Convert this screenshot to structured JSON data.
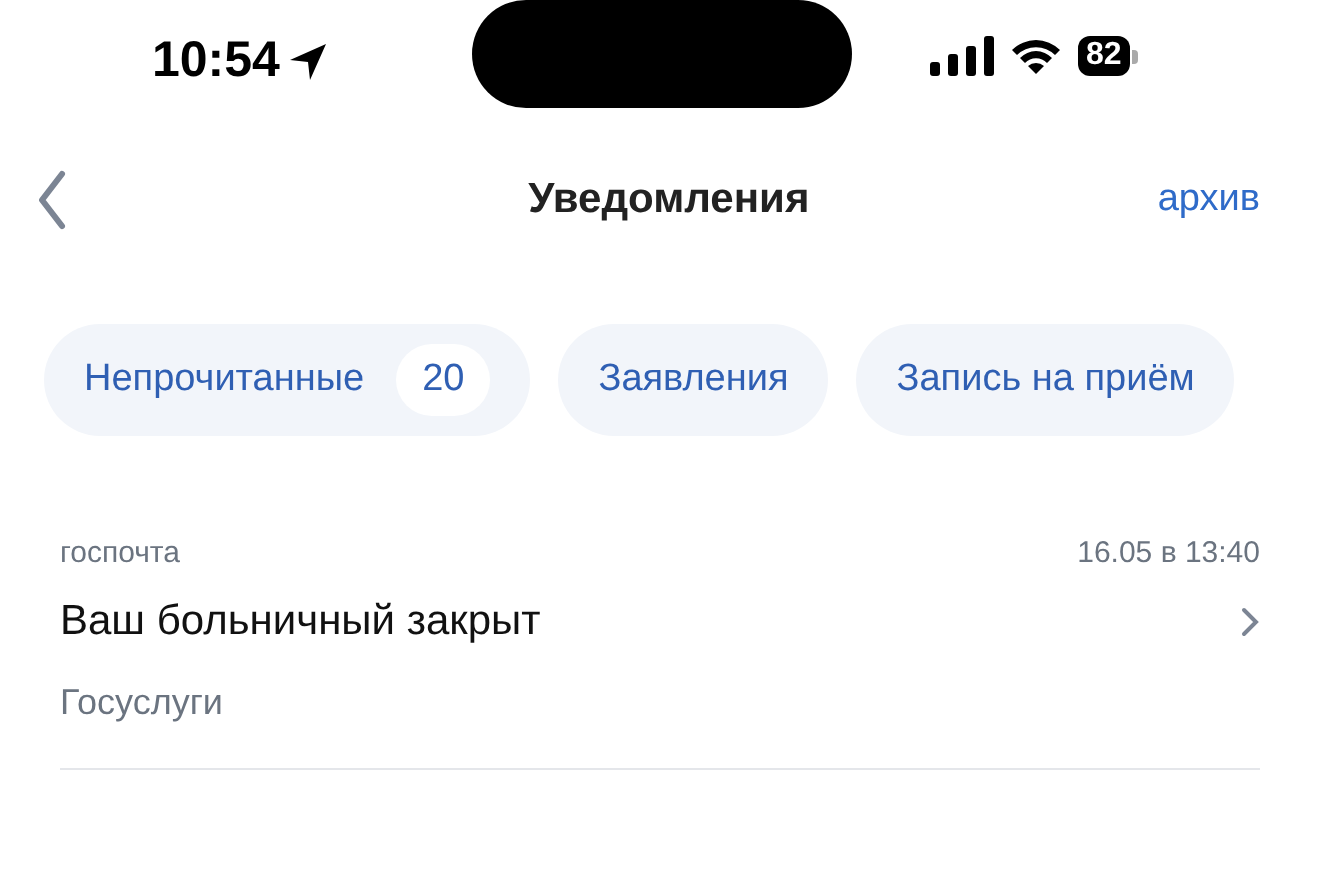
{
  "status_bar": {
    "time": "10:54",
    "battery": "82"
  },
  "nav": {
    "title": "Уведомления",
    "action": "архив"
  },
  "chips": [
    {
      "label": "Непрочитанные",
      "count": "20"
    },
    {
      "label": "Заявления"
    },
    {
      "label": "Запись на приём"
    }
  ],
  "notifications": [
    {
      "source": "госпочта",
      "date": "16.05 в 13:40",
      "title": "Ваш больничный закрыт",
      "sender": "Госуслуги"
    }
  ]
}
